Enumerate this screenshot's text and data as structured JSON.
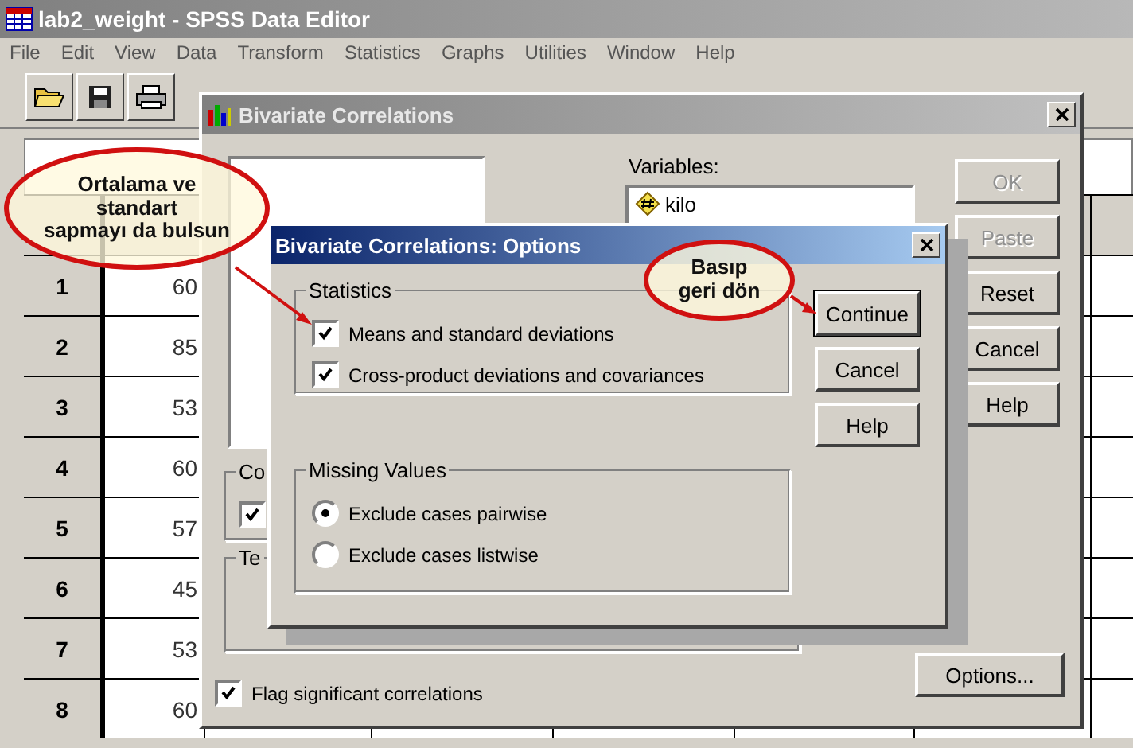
{
  "editor": {
    "title": "lab2_weight - SPSS Data Editor",
    "menu": [
      "File",
      "Edit",
      "View",
      "Data",
      "Transform",
      "Statistics",
      "Graphs",
      "Utilities",
      "Window",
      "Help"
    ],
    "grid": {
      "rows": [
        {
          "number": "1",
          "value": "60"
        },
        {
          "number": "2",
          "value": "85"
        },
        {
          "number": "3",
          "value": "53"
        },
        {
          "number": "4",
          "value": "60"
        },
        {
          "number": "5",
          "value": "57"
        },
        {
          "number": "6",
          "value": "45"
        },
        {
          "number": "7",
          "value": "53"
        },
        {
          "number": "8",
          "value": "60"
        }
      ]
    }
  },
  "bivariate_dialog": {
    "title": "Bivariate Correlations",
    "variables_label": "Variables:",
    "variables": [
      "kilo"
    ],
    "buttons": [
      {
        "label": "OK",
        "disabled": true
      },
      {
        "label": "Paste",
        "disabled": true
      },
      {
        "label": "Reset",
        "disabled": false
      },
      {
        "label": "Cancel",
        "disabled": false
      },
      {
        "label": "Help",
        "disabled": false
      }
    ],
    "coefficients_group": {
      "label": "Co",
      "checked": true
    },
    "test_group": {
      "label": "Te"
    },
    "flag_significant": {
      "label": "Flag significant correlations",
      "checked": true
    },
    "options_button": "Options..."
  },
  "options_dialog": {
    "title": "Bivariate Correlations: Options",
    "statistics": {
      "label": "Statistics",
      "items": [
        {
          "label": "Means and standard deviations",
          "checked": true
        },
        {
          "label": "Cross-product deviations and covariances",
          "checked": true
        }
      ]
    },
    "missing_values": {
      "label": "Missing Values",
      "items": [
        {
          "label": "Exclude cases pairwise",
          "selected": true
        },
        {
          "label": "Exclude cases listwise",
          "selected": false
        }
      ]
    },
    "buttons": [
      {
        "label": "Continue",
        "default": true
      },
      {
        "label": "Cancel",
        "default": false
      },
      {
        "label": "Help",
        "default": false
      }
    ]
  },
  "callouts": [
    {
      "lines": [
        "Ortalama ve",
        "standart",
        "sapmayı da bulsun"
      ]
    },
    {
      "lines": [
        "Basıp",
        "geri dön"
      ]
    }
  ]
}
